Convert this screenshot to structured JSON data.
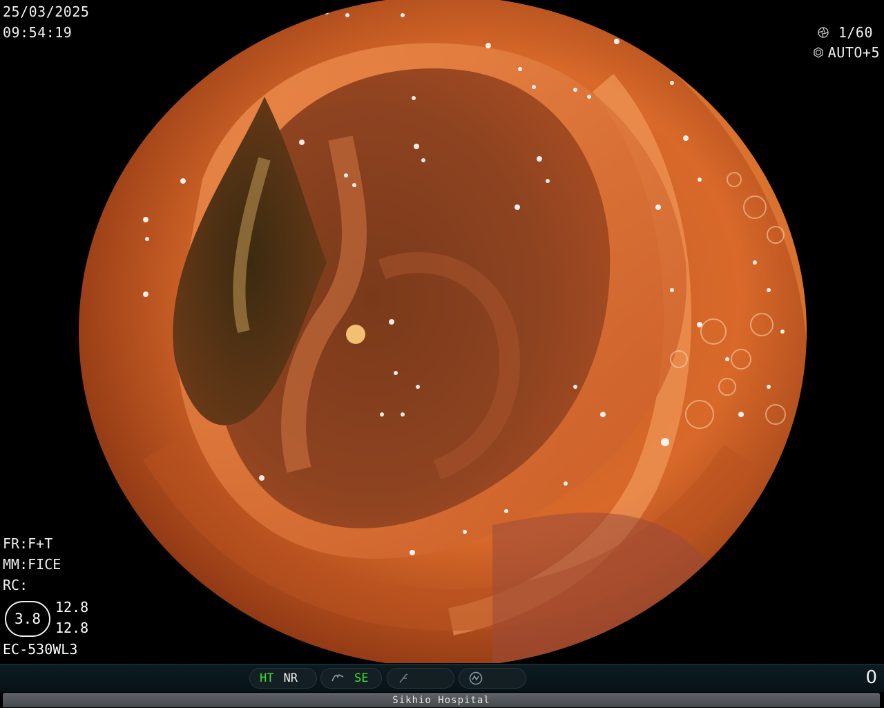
{
  "overlay": {
    "date": "25/03/2025",
    "time": "09:54:19",
    "shutter": "1/60",
    "exposure": "AUTO+5",
    "shutter_icon": "aperture-icon",
    "exposure_icon": "iris-icon"
  },
  "settings": {
    "fr": "FR:F+T",
    "mm": "MM:FICE",
    "rc": "RC:",
    "ratio": "3.8",
    "value_a": "12.8",
    "value_b": "12.8",
    "scope_model": "EC-530WL3"
  },
  "status_bar": {
    "ht": "HT",
    "nr": "NR",
    "se": "SE",
    "counter": "0",
    "icons": [
      "structure-enhancement-icon",
      "freeze-icon",
      "capture-icon"
    ]
  },
  "footer": {
    "hospital": "Sikhio Hospital"
  },
  "colors": {
    "tissue_bright": "#e8742c",
    "tissue_mid": "#b24a1e",
    "tissue_dark": "#3a1a08",
    "status_green": "#3adf3a"
  }
}
